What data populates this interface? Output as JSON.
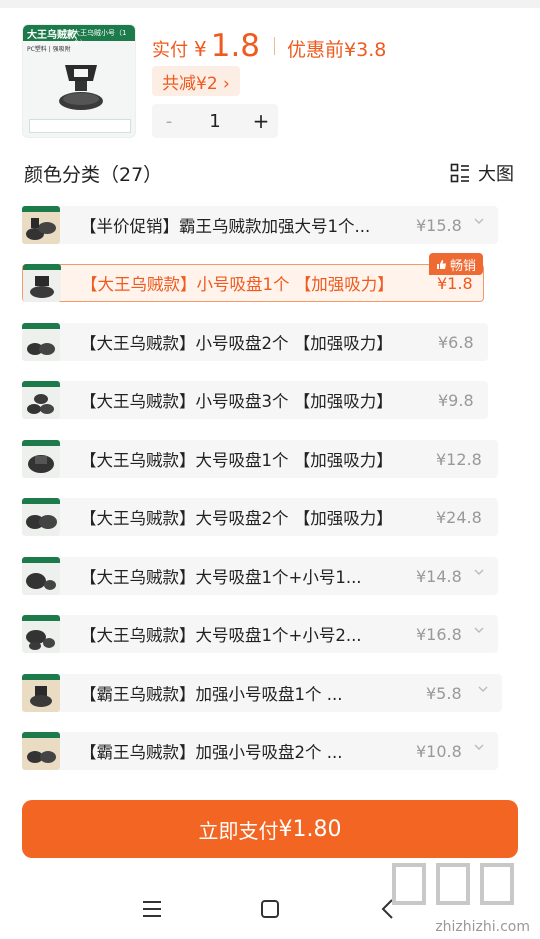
{
  "product": {
    "thumb_title": "大王乌贼款",
    "thumb_subtitle": "大王乌贼小号（1个）",
    "thumb_caption": "PC塑料 | 强吸附"
  },
  "price": {
    "label": "实付",
    "currency": "¥",
    "amount": "1.8",
    "before_label": "优惠前¥3.8",
    "discount": "共减¥2 ›"
  },
  "quantity": {
    "minus": "-",
    "value": "1",
    "plus": "+"
  },
  "section": {
    "title": "颜色分类（27）",
    "big_image_label": "大图"
  },
  "variants": [
    {
      "label": "【半价促销】霸王乌贼款加强大号1个...",
      "price": "¥15.8",
      "thumb": "tan",
      "selected": false
    },
    {
      "label": "【大王乌贼款】小号吸盘1个 【加强吸力】",
      "price": "¥1.8",
      "thumb": "gray",
      "selected": true,
      "badge": "畅销"
    },
    {
      "label": "【大王乌贼款】小号吸盘2个 【加强吸力】",
      "price": "¥6.8",
      "thumb": "gray",
      "selected": false
    },
    {
      "label": "【大王乌贼款】小号吸盘3个 【加强吸力】",
      "price": "¥9.8",
      "thumb": "gray",
      "selected": false
    },
    {
      "label": "【大王乌贼款】大号吸盘1个 【加强吸力】",
      "price": "¥12.8",
      "thumb": "gray",
      "selected": false
    },
    {
      "label": "【大王乌贼款】大号吸盘2个 【加强吸力】",
      "price": "¥24.8",
      "thumb": "gray",
      "selected": false
    },
    {
      "label": "【大王乌贼款】大号吸盘1个+小号1...",
      "price": "¥14.8",
      "thumb": "gray",
      "selected": false
    },
    {
      "label": "【大王乌贼款】大号吸盘1个+小号2...",
      "price": "¥16.8",
      "thumb": "gray",
      "selected": false
    },
    {
      "label": "【霸王乌贼款】加强小号吸盘1个 ...",
      "price": "¥5.8",
      "thumb": "tan",
      "selected": false
    },
    {
      "label": "【霸王乌贼款】加强小号吸盘2个 ...",
      "price": "¥10.8",
      "thumb": "tan",
      "selected": false
    }
  ],
  "pay_button": {
    "label": "立即支付",
    "amount": "¥1.80"
  },
  "watermark": "zhizhizhi.com",
  "colors": {
    "accent": "#f26522",
    "accent_text": "#ef5a1e",
    "selected_bg": "#fff3ec"
  }
}
